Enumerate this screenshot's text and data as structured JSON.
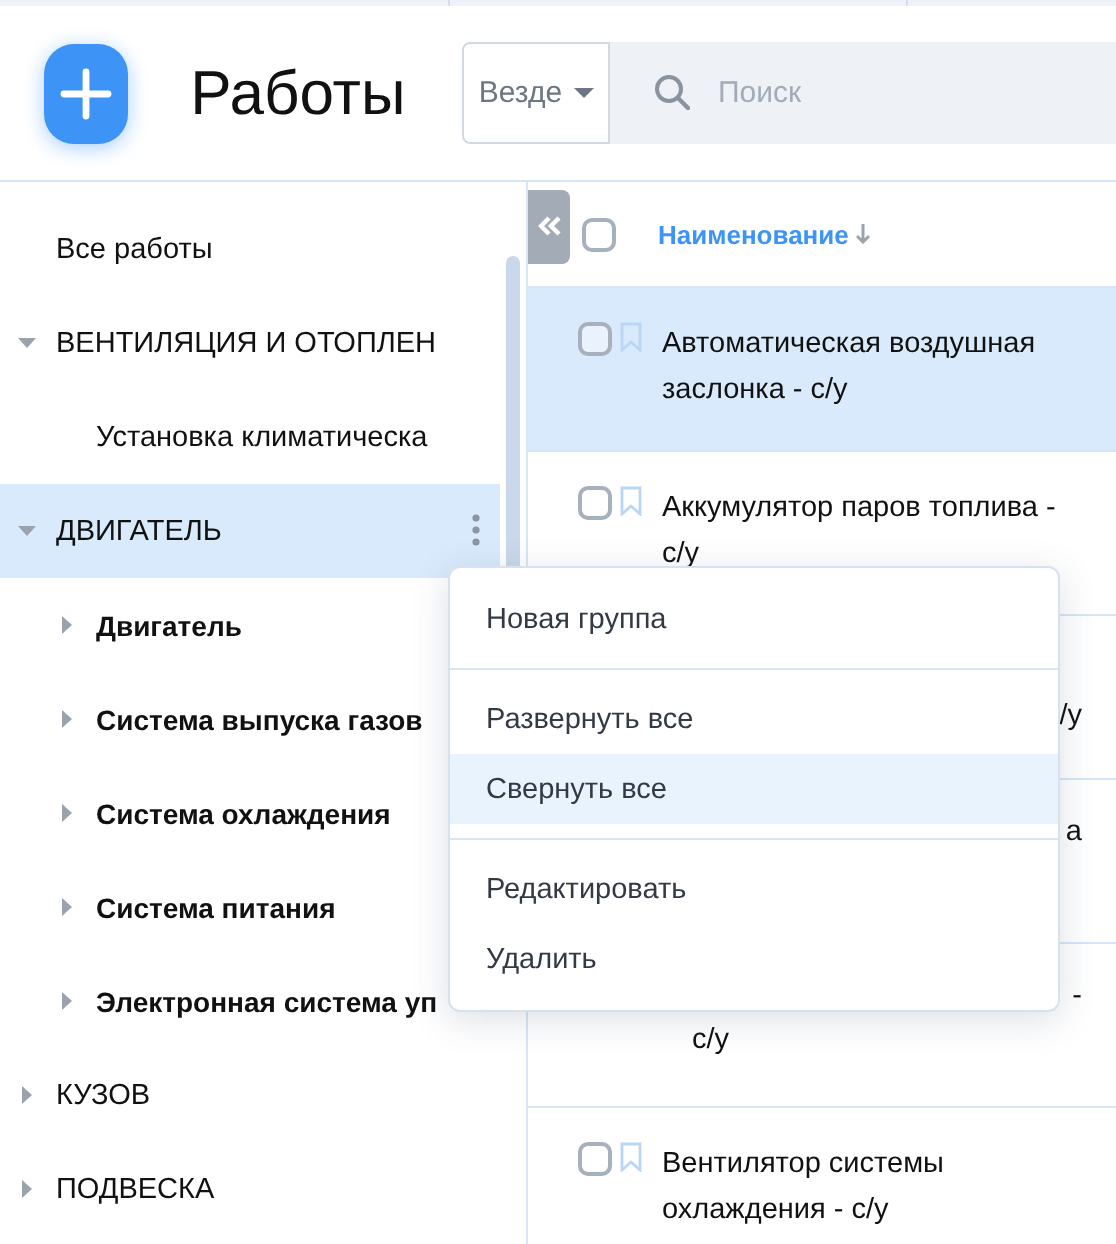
{
  "header": {
    "title": "Работы",
    "scope": "Везде",
    "search": {
      "placeholder": "Поиск"
    }
  },
  "tree": [
    {
      "label": "Все работы",
      "selected": false,
      "kind": "root"
    },
    {
      "label": "ВЕНТИЛЯЦИЯ И ОТОПЛЕН",
      "selected": false,
      "kind": "group",
      "expanded": true,
      "children": [
        {
          "label": "Установка климатическа",
          "selected": false,
          "kind": "leaf"
        }
      ]
    },
    {
      "label": "ДВИГАТЕЛЬ",
      "selected": true,
      "kind": "group",
      "expanded": true,
      "children": [
        {
          "label": "Двигатель",
          "selected": false,
          "kind": "sub",
          "expanded": false
        },
        {
          "label": "Система выпуска газов",
          "selected": false,
          "kind": "sub",
          "expanded": false
        },
        {
          "label": "Система охлаждения",
          "selected": false,
          "kind": "sub",
          "expanded": false
        },
        {
          "label": "Система питания",
          "selected": false,
          "kind": "sub",
          "expanded": false
        },
        {
          "label": "Электронная система уп",
          "selected": false,
          "kind": "sub",
          "expanded": false
        }
      ]
    },
    {
      "label": "КУЗОВ",
      "selected": false,
      "kind": "group",
      "expanded": false
    },
    {
      "label": "ПОДВЕСКА",
      "selected": false,
      "kind": "group",
      "expanded": false
    }
  ],
  "list": {
    "column": "Наименование",
    "all_checked": false,
    "rows": [
      {
        "kind": "full",
        "text": "Автоматическая воздушная заслонка - с/у",
        "selected": true,
        "checked": false
      },
      {
        "kind": "full",
        "text": "Аккумулятор паров топлива - с/у",
        "selected": false,
        "checked": false
      },
      {
        "kind": "covered",
        "bottom_end": "/у"
      },
      {
        "kind": "covered",
        "top_end": "а"
      },
      {
        "kind": "covered",
        "top_end": "-",
        "bottom_start": "с/у"
      },
      {
        "kind": "full",
        "text": "Вентилятор системы охлаждения - с/у",
        "selected": false,
        "checked": false
      }
    ]
  },
  "menu": {
    "groups": [
      [
        {
          "label": "Новая группа",
          "highlighted": false
        }
      ],
      [
        {
          "label": "Развернуть все",
          "highlighted": false
        },
        {
          "label": "Свернуть все",
          "highlighted": true
        }
      ],
      [
        {
          "label": "Редактировать",
          "highlighted": false
        },
        {
          "label": "Удалить",
          "highlighted": false
        }
      ]
    ]
  }
}
